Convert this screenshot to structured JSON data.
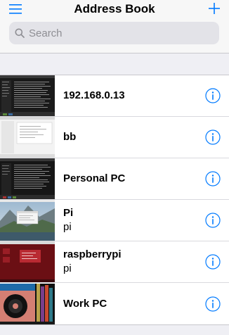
{
  "navbar": {
    "title": "Address Book",
    "menu_icon": "hamburger-icon",
    "add_icon": "plus-icon"
  },
  "search": {
    "placeholder": "Search",
    "icon": "search-icon"
  },
  "accent_color": "#007aff",
  "hosts": [
    {
      "title": "192.168.0.13",
      "subtitle": "",
      "thumb": "dark-terminal"
    },
    {
      "title": "bb",
      "subtitle": "",
      "thumb": "white-window"
    },
    {
      "title": "Personal PC",
      "subtitle": "",
      "thumb": "dark-terminal"
    },
    {
      "title": "Pi",
      "subtitle": "pi",
      "thumb": "landscape-desktop"
    },
    {
      "title": "raspberrypi",
      "subtitle": "pi",
      "thumb": "red-desktop"
    },
    {
      "title": "Work PC",
      "subtitle": "",
      "thumb": "vinyl-desktop"
    }
  ]
}
